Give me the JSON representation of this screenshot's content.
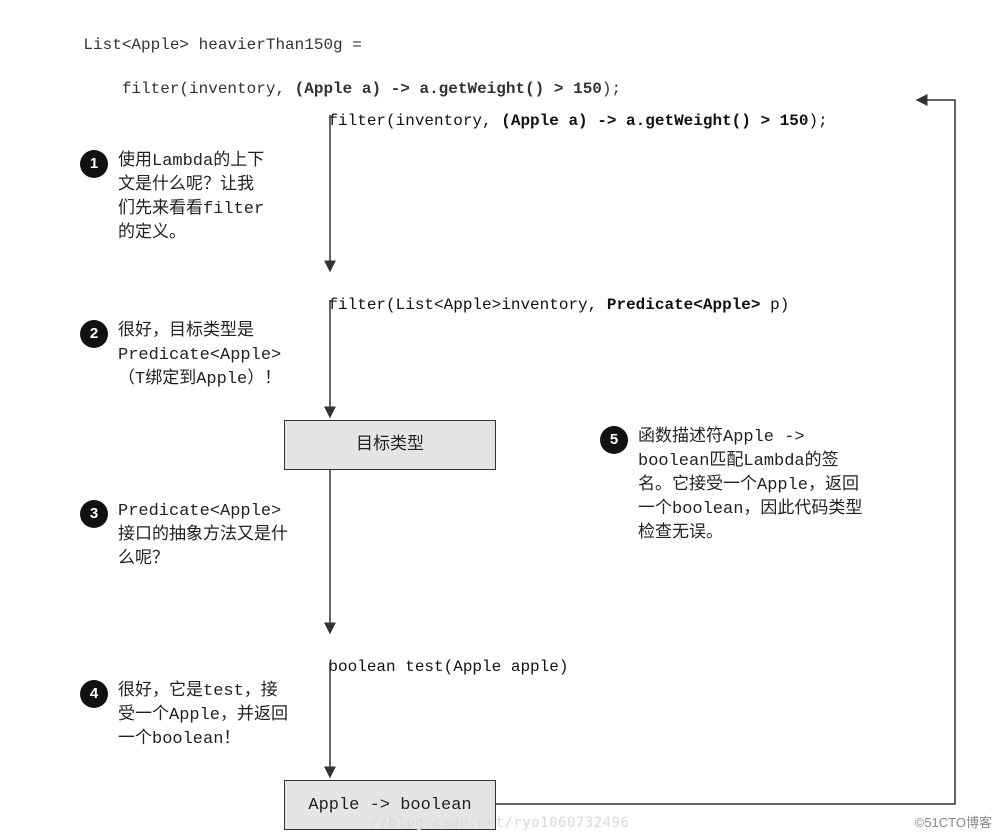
{
  "code": {
    "line1a": "List<Apple> heavierThan150g =",
    "line2_pre": "    filter(inventory, ",
    "line2_bold": "(Apple a) -> a.getWeight() > 150",
    "line2_post": ");"
  },
  "flow": {
    "top_pre": "filter(inventory, ",
    "top_bold": "(Apple a) -> a.getWeight() > 150",
    "top_post": ");",
    "filter_sig_pre": "filter(List<Apple>inventory, ",
    "filter_sig_bold": "Predicate<Apple>",
    "filter_sig_post": " p)",
    "box_target": "目标类型",
    "test_sig": "boolean test(Apple apple)",
    "box_result": "Apple -> boolean"
  },
  "steps": {
    "s1": {
      "num": "1",
      "text": "使用Lambda的上下文是什么呢？让我们先来看看filter的定义。"
    },
    "s2": {
      "num": "2",
      "text": "很好，目标类型是Predicate<Apple>（T绑定到Apple）！"
    },
    "s3": {
      "num": "3",
      "text": "Predicate<Apple>接口的抽象方法又是什么呢？"
    },
    "s4": {
      "num": "4",
      "text": "很好，它是test，接受一个Apple，并返回一个boolean！"
    },
    "s5": {
      "num": "5",
      "text": "函数描述符Apple -> boolean匹配Lambda的签名。它接受一个Apple，返回一个boolean，因此代码类型检查无误。"
    }
  },
  "watermark": "//blog.csdn.net/ryo1060732496",
  "attribution": "©51CTO博客"
}
